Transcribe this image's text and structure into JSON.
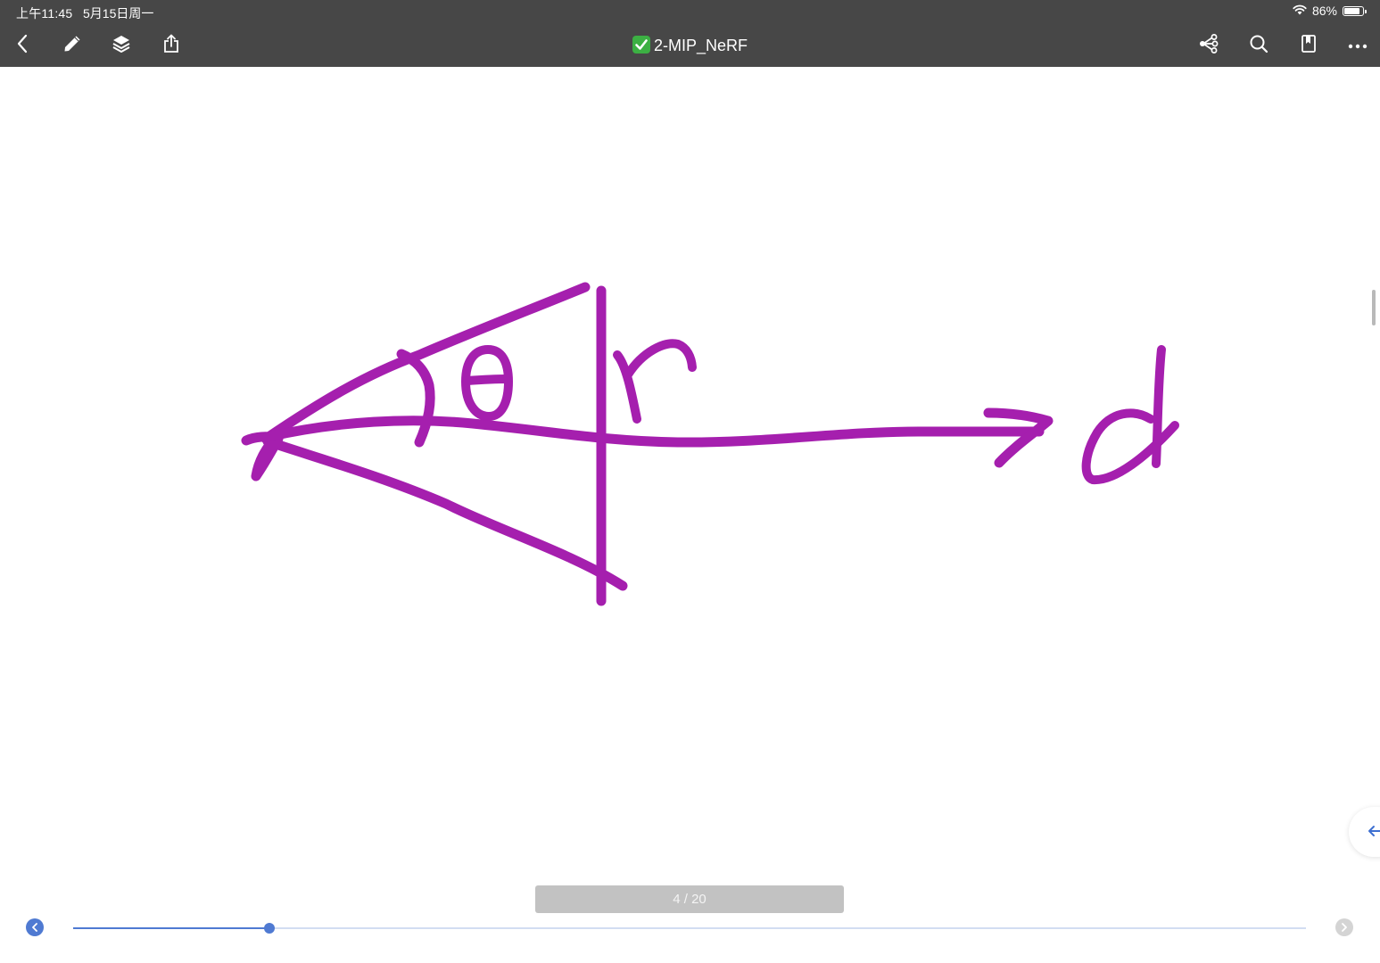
{
  "status": {
    "time": "上午11:45",
    "date": "5月15日周一",
    "battery_percent": "86%",
    "battery_level": 0.86
  },
  "toolbar": {
    "left_icons": [
      "back-chevron-icon",
      "pencil-icon",
      "layers-icon",
      "share-icon"
    ],
    "title": "2-MIP_NeRF",
    "title_prefix_icon": "check-mark-button-icon",
    "right_icons": [
      "mind-map-icon",
      "search-icon",
      "bookmark-icon",
      "more-icon"
    ]
  },
  "drawing": {
    "ink_color": "#a51fae",
    "labels": [
      "θ",
      "r",
      "d"
    ]
  },
  "pager": {
    "label": "4 / 20",
    "current_page": 4,
    "total_pages": 20,
    "progress": 0.159
  },
  "colors": {
    "topbar": "#474747",
    "accent": "#4f7ad2"
  }
}
